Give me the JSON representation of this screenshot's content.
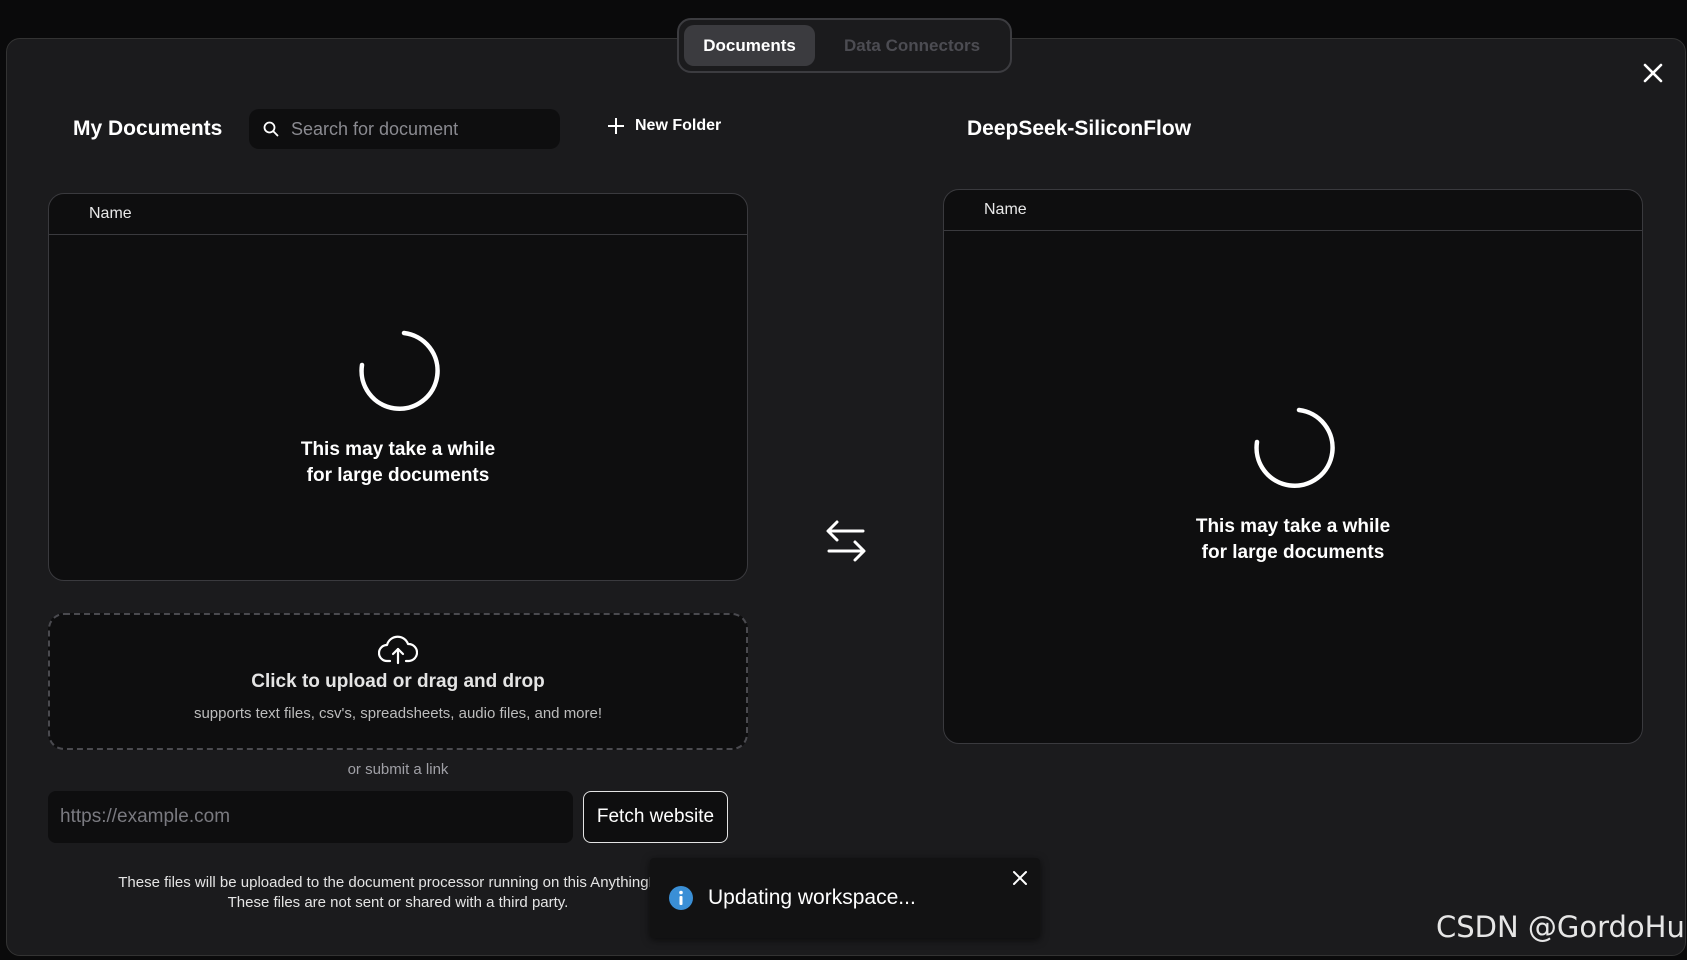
{
  "tabs": [
    {
      "label": "Documents",
      "active": true
    },
    {
      "label": "Data Connectors",
      "active": false
    }
  ],
  "left": {
    "title": "My Documents",
    "search_placeholder": "Search for document",
    "new_folder_label": "New Folder",
    "column_name": "Name",
    "loading_text": "This may take a while for large documents"
  },
  "right": {
    "title": "DeepSeek-SiliconFlow",
    "column_name": "Name",
    "loading_text": "This may take a while for large documents"
  },
  "upload": {
    "title": "Click to upload or drag and drop",
    "subtitle": "supports text files, csv's, spreadsheets, audio files, and more!",
    "or_link": "or submit a link",
    "url_placeholder": "https://example.com",
    "fetch_label": "Fetch website"
  },
  "disclaimer": {
    "line1": "These files will be uploaded to the document processor running on this AnythingLLM",
    "line2": "These files are not sent or shared with a third party."
  },
  "toast": {
    "message": "Updating workspace..."
  },
  "watermark": "CSDN @GordoHu",
  "icons": {
    "search": "search-icon",
    "plus": "plus-icon",
    "close": "close-icon",
    "swap": "swap-arrows-icon",
    "upload": "cloud-upload-icon",
    "info": "info-icon",
    "spinner": "spinner-icon"
  },
  "colors": {
    "background": "#1b1b1d",
    "panel": "#0e0e0f",
    "info_blue": "#3a8fd6"
  }
}
